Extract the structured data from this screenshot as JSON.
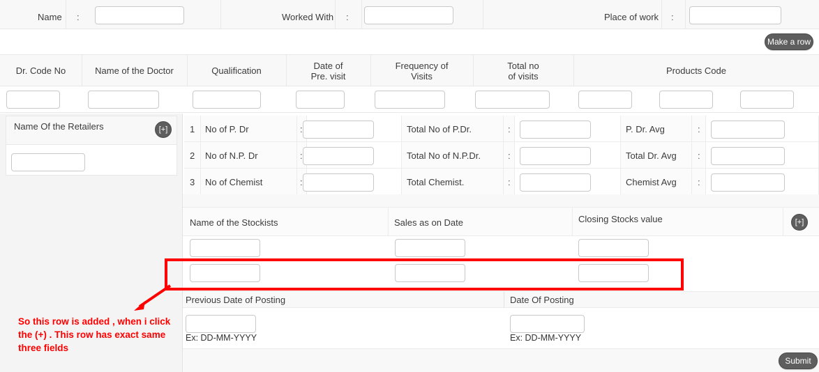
{
  "colors": {
    "accent_button": "#5e5e5e",
    "highlight": "#ff0000",
    "header_bg": "#f8f8f8",
    "border": "#e8e8e8"
  },
  "top_bar": {
    "fields": [
      {
        "label": "Name",
        "separator": ":",
        "value": "",
        "placeholder": ""
      },
      {
        "label": "Worked With",
        "separator": ":",
        "value": "",
        "placeholder": ""
      },
      {
        "label": "Place of work",
        "separator": ":",
        "value": "",
        "placeholder": ""
      }
    ]
  },
  "toolbar": {
    "make_row_label": "Make a row"
  },
  "doctor_table": {
    "headers": [
      "Dr. Code No",
      "Name of the Doctor",
      "Qualification",
      "Date of\nPre. visit",
      "Frequency of\nVisits",
      "Total no\nof visits",
      "Products Code"
    ],
    "header_lines": {
      "date_of_pre_visit": [
        "Date of",
        "Pre. visit"
      ],
      "frequency_of_visits": [
        "Frequency of",
        "Visits"
      ],
      "total_no_of_visits": [
        "Total no",
        "of visits"
      ]
    },
    "row_values": [
      "",
      "",
      "",
      "",
      "",
      "",
      "",
      "",
      "",
      ""
    ]
  },
  "retailers": {
    "title": "Name Of the Retailers",
    "add_button_label": "[+]",
    "rows": [
      {
        "value": "",
        "placeholder": ""
      }
    ]
  },
  "counts": {
    "rows": [
      {
        "index": "1",
        "left_label": "No of P. Dr",
        "left_sep": ":",
        "left_value": "",
        "mid_label": "Total No of P.Dr.",
        "mid_sep": ":",
        "mid_value": "",
        "right_label": "P. Dr. Avg",
        "right_sep": ":",
        "right_value": ""
      },
      {
        "index": "2",
        "left_label": "No of N.P. Dr",
        "left_sep": ":",
        "left_value": "",
        "mid_label": "Total No of N.P.Dr.",
        "mid_sep": ":",
        "mid_value": "",
        "right_label": "Total Dr. Avg",
        "right_sep": ":",
        "right_value": ""
      },
      {
        "index": "3",
        "left_label": "No of Chemist",
        "left_sep": ":",
        "left_value": "",
        "mid_label": "Total Chemist.",
        "mid_sep": ":",
        "mid_value": "",
        "right_label": "Chemist Avg",
        "right_sep": ":",
        "right_value": ""
      }
    ]
  },
  "stockists": {
    "headers": [
      "Name of the Stockists",
      "Sales as on Date",
      "Closing Stocks value"
    ],
    "add_button_label": "[+]",
    "rows": [
      {
        "name": "",
        "sales": "",
        "closing": ""
      },
      {
        "name": "",
        "sales": "",
        "closing": ""
      }
    ]
  },
  "annotation": {
    "text": "So this row is added , when i click the (+) . This row has exact same three fields"
  },
  "posting": {
    "previous_label": "Previous Date of Posting",
    "previous_value": "",
    "previous_hint": "Ex: DD-MM-YYYY",
    "current_label": "Date Of Posting",
    "current_value": "",
    "current_hint": "Ex: DD-MM-YYYY"
  },
  "footer": {
    "submit_label": "Submit"
  }
}
